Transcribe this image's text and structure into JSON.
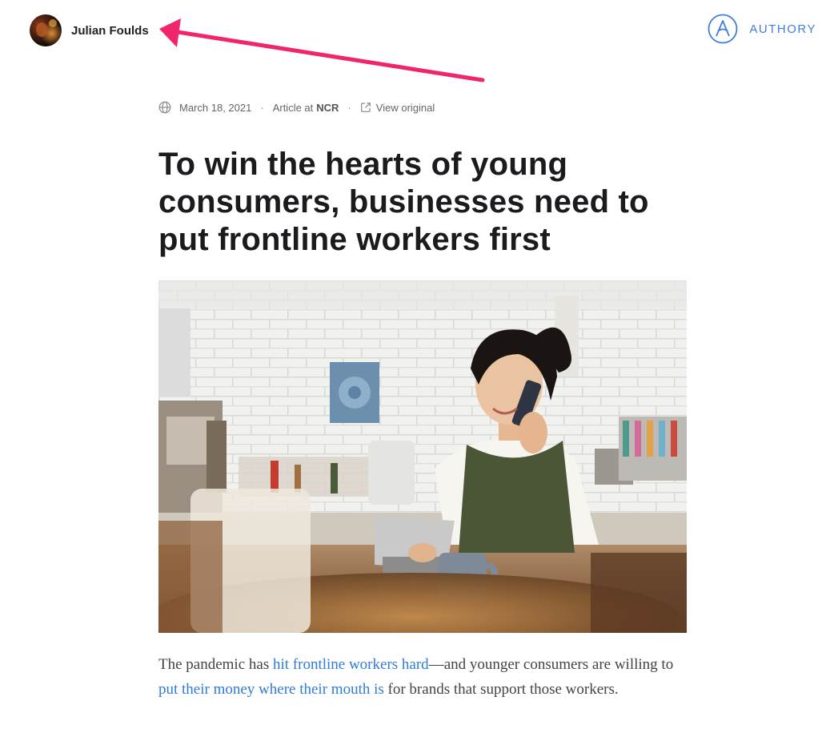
{
  "author": {
    "name": "Julian Foulds"
  },
  "brand": {
    "name": "AUTHORY",
    "color": "#3d7fdc"
  },
  "meta": {
    "date": "March 18, 2021",
    "separator": "·",
    "type_label": "Article at",
    "publication": "NCR",
    "view_original": "View original",
    "icons": [
      "globe-icon",
      "external-link-icon"
    ]
  },
  "article": {
    "title": "To win the hearts of young consumers, businesses need to put frontline workers first",
    "hero_image": "woman-on-phone-at-cafe-counter",
    "intro": {
      "part1": "The pandemic has ",
      "link1": "hit frontline workers hard",
      "part2": "—and younger consumers are willing to ",
      "link2": "put their money where their mouth is",
      "part3": " for brands that support those workers."
    }
  },
  "annotation": {
    "color": "#f0256b"
  },
  "colors": {
    "link": "#2f7bd8",
    "text": "#1b1b1f"
  }
}
